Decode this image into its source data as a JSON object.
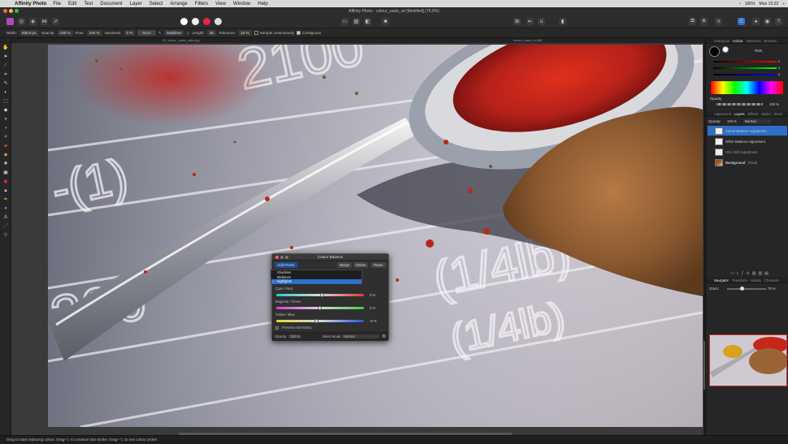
{
  "menubar": {
    "app": "Affinity Photo",
    "items": [
      "File",
      "Edit",
      "Text",
      "Document",
      "Layer",
      "Select",
      "Arrange",
      "Filters",
      "View",
      "Window",
      "Help"
    ],
    "battery": "100%",
    "clock": "Mon 15:23"
  },
  "window": {
    "title": "Affinity Photo - colour_casts_wt [Modified] (75.0%)",
    "doc_tab": "colour_casts_wt [M]",
    "file_tab": "02_colour_casts_after.jpg"
  },
  "context": {
    "width_label": "Width:",
    "width_value": "838.8 px",
    "opacity_label": "Opacity:",
    "opacity_value": "100 %",
    "flow_label": "Flow:",
    "flow_value": "100 %",
    "hardness_label": "Hardness:",
    "hardness_value": "0 %",
    "more": "More",
    "stabiliser": "Stabiliser",
    "length_label": "Length:",
    "length_value": "35",
    "tolerance_label": "Tolerance:",
    "tolerance_value": "10 %",
    "sample_continuously": "Sample continuously",
    "contiguous": "Contiguous"
  },
  "status": "Drag to start replacing colour. Drag+⇧ to continue last stroke. Drag+⌥ to use colour picker.",
  "panel": {
    "top_tabs": [
      "Histogram",
      "Colour",
      "Swatches",
      "Brushes"
    ],
    "mode": "RGB",
    "channels": [
      {
        "name": "R",
        "value": "0"
      },
      {
        "name": "G",
        "value": "0"
      },
      {
        "name": "B",
        "value": "0"
      }
    ],
    "opacity_label": "Opacity",
    "opacity_value": "100 %",
    "layer_tabs": [
      "Adjustment",
      "Layers",
      "Effects",
      "Styles",
      "Stock"
    ],
    "layer_opacity_label": "Opacity:",
    "layer_opacity": "100 %",
    "blend": "Normal",
    "layers": [
      {
        "name": "Colour Balance Adjustment",
        "selected": true
      },
      {
        "name": "White Balance Adjustment",
        "selected": false
      },
      {
        "name": "HSL Shift Adjustment",
        "selected": false
      },
      {
        "name": "Background",
        "suffix": "(Pixel)",
        "selected": false
      }
    ],
    "nav_tabs": [
      "Navigator",
      "Transform",
      "History",
      "Channels"
    ],
    "zoom_label": "Zoom:",
    "zoom_value": "75 %"
  },
  "dialog": {
    "title": "Colour Balance",
    "add_preset": "Add Preset",
    "merge": "Merge",
    "delete": "Delete",
    "reset": "Reset",
    "menu": [
      {
        "label": "Shadows",
        "checked": false
      },
      {
        "label": "Midtones",
        "checked": false
      },
      {
        "label": "Highlights",
        "checked": true
      }
    ],
    "sliders": [
      {
        "label": "Cyan / Red",
        "value": "0 %",
        "level": 0.5
      },
      {
        "label": "Magenta / Green",
        "value": "0 %",
        "level": 0.5
      },
      {
        "label": "Yellow / Blue",
        "value": "-8 %",
        "level": 0.46
      }
    ],
    "preserve": "Preserve luminosity",
    "opacity_label": "Opacity:",
    "opacity_value": "100 %",
    "blend_label": "Blend Mode:",
    "blend_value": "Normal"
  },
  "canvas_text": {
    "n1": "2100",
    "n2": "(1/4lb)",
    "n3": "(1/4lb)",
    "n4": "300",
    "n5": "-(1)"
  },
  "colors": {
    "accent": "#2d6fc9",
    "paprika": "#c8261a",
    "cumin": "#9a6434"
  }
}
